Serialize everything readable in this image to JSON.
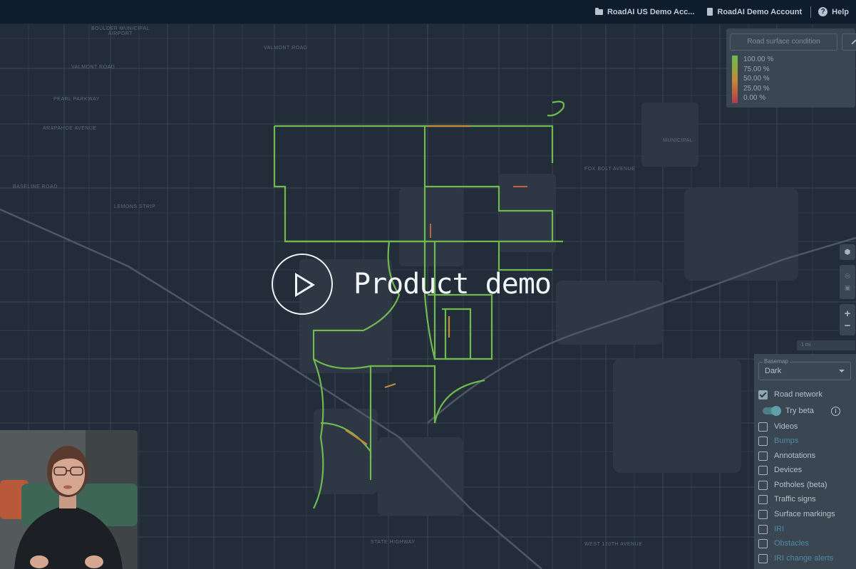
{
  "topbar": {
    "workspace": "RoadAI US Demo Acc...",
    "account": "RoadAI Demo Account",
    "help": "Help"
  },
  "legend": {
    "metric_button": "Road surface condition",
    "stops": [
      "100.00 %",
      "75.00 %",
      "50.00 %",
      "25.00 %",
      "0.00 %"
    ],
    "colors": [
      "#6fb94f",
      "#8ca83f",
      "#c48a37",
      "#c0623e",
      "#b23a55"
    ]
  },
  "map_labels": {
    "airport": "BOULDER MUNICIPAL\nAIRPORT",
    "valmont_road": "VALMONT ROAD",
    "valmont_road_2": "VALMONT ROAD",
    "pearl_parkway": "PEARL PARKWAY",
    "arapahoe": "ARAPAHOE AVENUE",
    "baseline": "BASELINE ROAD",
    "lemons": "LEMONS STRIP",
    "state_highway": "STATE HIGHWAY",
    "west_120th": "WEST 120TH AVENUE",
    "fox_bolt": "FOX BOLT AVENUE",
    "municipal": "MUNICIPAL"
  },
  "controls": {
    "zoom_in": "+",
    "zoom_out": "−",
    "scale": "1 mi"
  },
  "layers": {
    "basemap_label": "Basemap",
    "basemap_value": "Dark",
    "items": [
      {
        "label": "Road network",
        "checked": true
      },
      {
        "label": "Try beta",
        "toggle": true
      },
      {
        "label": "Videos",
        "checked": false
      },
      {
        "label": "Bumps",
        "checked": false,
        "beta_link": true
      },
      {
        "label": "Annotations",
        "checked": false
      },
      {
        "label": "Devices",
        "checked": false
      },
      {
        "label": "Potholes (beta)",
        "checked": false
      },
      {
        "label": "Traffic signs",
        "checked": false
      },
      {
        "label": "Surface markings",
        "checked": false
      },
      {
        "label": "IRI",
        "checked": false,
        "beta_link": true
      },
      {
        "label": "Obstacles",
        "checked": false,
        "beta_link": true
      },
      {
        "label": "IRI change alerts",
        "checked": false,
        "beta_link": true
      }
    ]
  },
  "overlay": {
    "title": "Product demo"
  }
}
